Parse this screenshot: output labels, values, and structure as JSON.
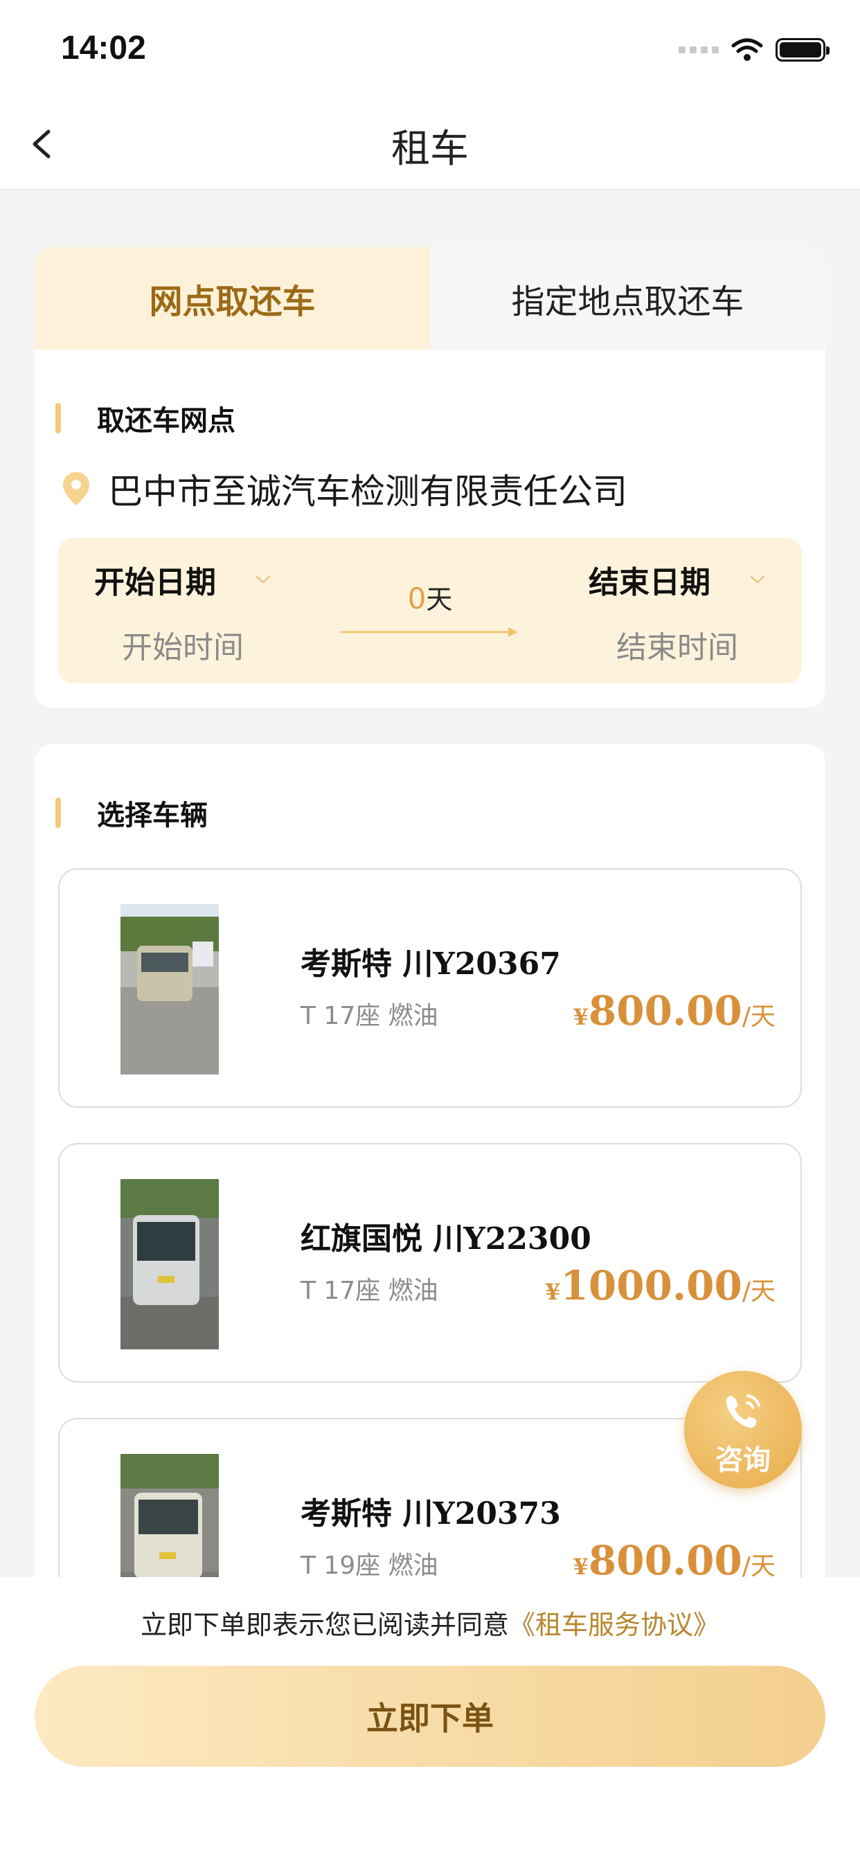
{
  "status_bar": {
    "time": "14:02"
  },
  "header": {
    "title": "租车"
  },
  "tabs": [
    {
      "label": "网点取还车",
      "active": true
    },
    {
      "label": "指定地点取还车",
      "active": false
    }
  ],
  "pickup": {
    "section_title": "取还车网点",
    "location": "巴中市至诚汽车检测有限责任公司",
    "start_label": "开始日期",
    "start_placeholder": "开始时间",
    "end_label": "结束日期",
    "end_placeholder": "结束时间",
    "days_count": "0",
    "days_unit": "天"
  },
  "vehicles_section": {
    "title": "选择车辆",
    "items": [
      {
        "name_cn": "考斯特 川",
        "plate": "Y20367",
        "spec": "T 17座 燃油",
        "currency": "¥",
        "price": "800.00",
        "unit": "/天"
      },
      {
        "name_cn": "红旗国悦 川",
        "plate": "Y22300",
        "spec": "T 17座 燃油",
        "currency": "¥",
        "price": "1000.00",
        "unit": "/天"
      },
      {
        "name_cn": "考斯特 川",
        "plate": "Y20373",
        "spec": "T 19座 燃油",
        "currency": "¥",
        "price": "800.00",
        "unit": "/天"
      }
    ]
  },
  "consult": {
    "label": "咨询"
  },
  "footer": {
    "agreement_prefix": "立即下单即表示您已阅读并同意",
    "agreement_link": "《租车服务协议》",
    "order_button": "立即下单"
  },
  "colors": {
    "accent": "#e2a245",
    "tab_active_bg": "#fdf2d9",
    "price": "#d8913a"
  }
}
